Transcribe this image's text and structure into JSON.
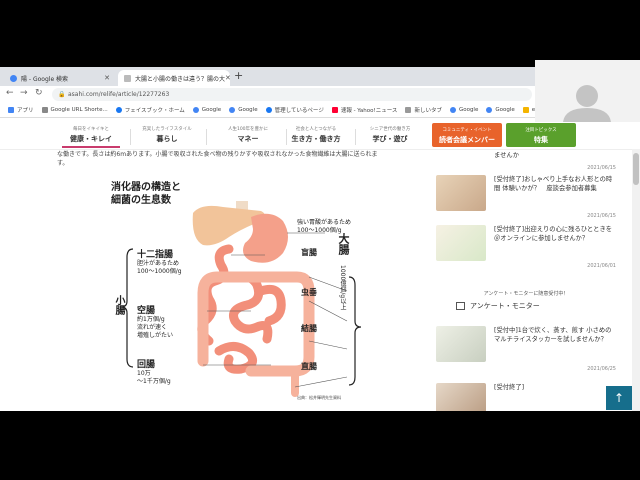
{
  "browser": {
    "tabs": [
      {
        "title": "陽 - Google 検索",
        "active": false
      },
      {
        "title": "大腸と小腸の働きは違う？腸の大",
        "active": true
      }
    ],
    "new_tab": "+",
    "url": "asahi.com/relife/article/12277263",
    "bookmarks": [
      "アプリ",
      "Google URL Shorte...",
      "フェイスブック・ホーム",
      "Google",
      "Google",
      "管理しているページ",
      "速報 - Yahoo!ニュース",
      "新しいタブ",
      "Google",
      "Google",
      "e54e3e22008"
    ]
  },
  "site_nav": {
    "items": [
      {
        "sub": "毎日をイキイキと",
        "main": "健康・キレイ",
        "color": "#c93b6d"
      },
      {
        "sub": "充実したライフスタイル",
        "main": "暮らし",
        "color": "#5aa02c"
      },
      {
        "sub": "人生100年を豊かに",
        "main": "マネー",
        "color": "#3a7bd5"
      },
      {
        "sub": "社会と人とつながる",
        "main": "生き方・働き方",
        "color": "#e8632b"
      },
      {
        "sub": "シニア世代の働き方",
        "main": "学び・遊び",
        "color": "#2c9aa0"
      }
    ],
    "community": {
      "sub": "コミュニティ・イベント",
      "main": "読者会議メンバー"
    },
    "special": {
      "sub": "注目トピックス",
      "main": "特集"
    }
  },
  "article": {
    "lines": [
      "な働きです。長さは約6mあります。小腸で吸収された食べ物の残りかすや吸収されなかった食物繊維は大腸に送られま",
      "す。"
    ]
  },
  "figure": {
    "title_line1": "消化器の構造と",
    "title_line2": "細菌の生息数",
    "stomach_note_1": "強い胃酸があるため",
    "stomach_note_2": "100〜1000個/g",
    "small_intestine": "小腸",
    "duodenum": "十二指腸",
    "duodenum_note_1": "胆汁があるため",
    "duodenum_note_2": "100〜1000個/g",
    "jejunum": "空腸",
    "jejunum_note_1": "約1万個/g",
    "jejunum_note_2": "流れが速く",
    "jejunum_note_3": "増殖しがたい",
    "ileum": "回腸",
    "ileum_note_1": "10万",
    "ileum_note_2": "〜1千万個/g",
    "large_intestine": "大腸",
    "large_note": "1000億個/g以上",
    "cecum": "盲腸",
    "appendix": "虫垂",
    "colon": "結腸",
    "rectum": "直腸",
    "source": "出典：松井輝明先生資料"
  },
  "sidebar": {
    "cards": [
      {
        "title": "ませんか",
        "date": "2021/06/15"
      },
      {
        "title": "[受付終了]おしゃべり上手なお人形との時間 体験いかが？　座談会参加者募集",
        "date": "2021/06/15"
      },
      {
        "title": "[受付終了]出迎えりの心に残るひとときを＠オンラインに参加しませんか？",
        "date": "2021/06/01"
      },
      {
        "title": "[受付中]1台で炊く、蒸す、煎す 小さめのマルチライスタッカーを試しませんか？",
        "date": "2021/06/25"
      },
      {
        "title": "[受付終了]",
        "date": ""
      }
    ],
    "enquete_sub": "アンケート・モニターに随意受付中！",
    "enquete_title": "アンケート・モニター"
  },
  "top_button": "↑"
}
